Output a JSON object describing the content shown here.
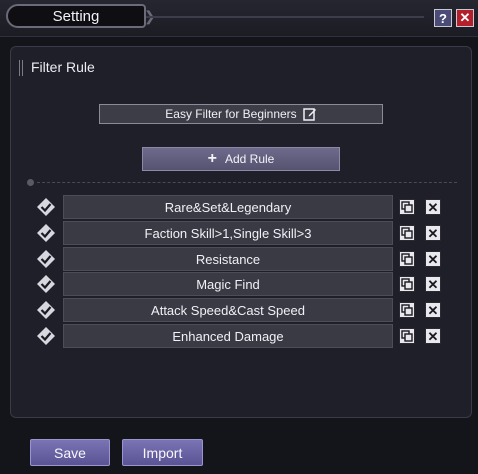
{
  "window": {
    "title": "Setting",
    "help_label": "?",
    "close_label": "✕"
  },
  "panel": {
    "section_title": "Filter Rule",
    "easy_filter_label": "Easy Filter for Beginners",
    "add_rule_label": "Add Rule",
    "add_rule_icon": "+"
  },
  "rules": [
    {
      "name": "Rare&Set&Legendary"
    },
    {
      "name": "Faction Skill>1,Single Skill>3"
    },
    {
      "name": "Resistance"
    },
    {
      "name": "Magic Find"
    },
    {
      "name": "Attack Speed&Cast Speed"
    },
    {
      "name": "Enhanced Damage"
    }
  ],
  "rule_delete_label": "✕",
  "footer": {
    "save_label": "Save",
    "import_label": "Import"
  },
  "colors": {
    "accent": "#6a63a8",
    "close_red": "#b31f2a",
    "help_blue": "#4b4b78"
  }
}
